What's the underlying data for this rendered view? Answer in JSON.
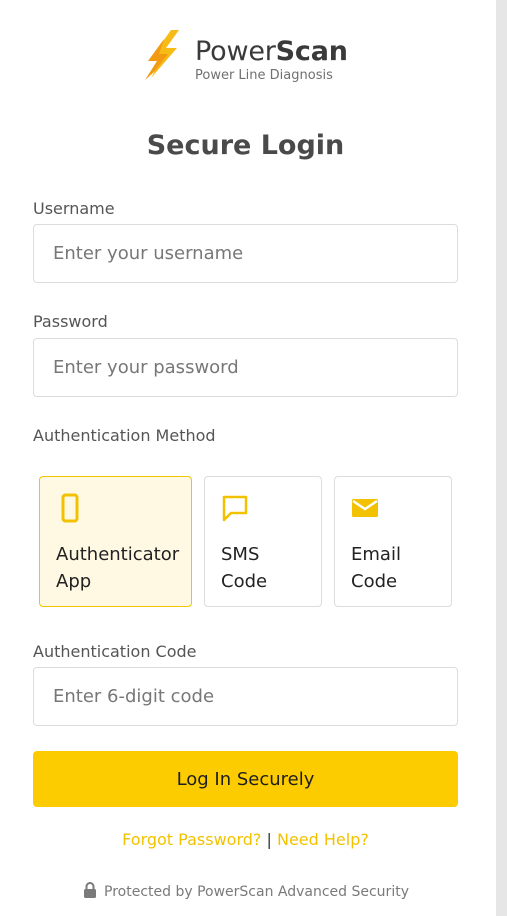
{
  "brand": {
    "name_light": "Power",
    "name_bold": "Scan",
    "tagline": "Power Line Diagnosis"
  },
  "login": {
    "title": "Secure Login"
  },
  "username": {
    "label": "Username",
    "placeholder": "Enter your username",
    "value": ""
  },
  "password": {
    "label": "Password",
    "placeholder": "Enter your password",
    "value": ""
  },
  "auth_method": {
    "label": "Authentication Method",
    "options": [
      {
        "label_line1": "Authenticator",
        "label_line2": "App",
        "icon": "smartphone-icon",
        "selected": true
      },
      {
        "label_line1": "SMS",
        "label_line2": "Code",
        "icon": "message-icon",
        "selected": false
      },
      {
        "label_line1": "Email",
        "label_line2": "Code",
        "icon": "mail-icon",
        "selected": false
      }
    ]
  },
  "auth_code": {
    "label": "Authentication Code",
    "placeholder": "Enter 6-digit code",
    "value": ""
  },
  "actions": {
    "submit_label": "Log In Securely",
    "forgot_label": "Forgot Password?",
    "separator": "|",
    "help_label": "Need Help?"
  },
  "footer": {
    "security_note": "Protected by PowerScan Advanced Security"
  },
  "colors": {
    "accent": "#fdcc00",
    "link": "#f2c200",
    "selected_bg": "#fff9e3",
    "selected_border": "#f2c500",
    "text_dark": "#333333"
  }
}
